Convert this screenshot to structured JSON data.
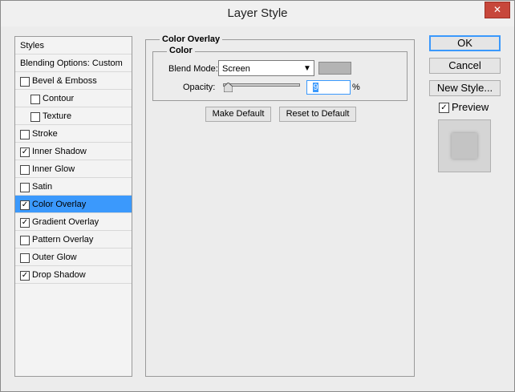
{
  "window": {
    "title": "Layer Style",
    "close_glyph": "✕"
  },
  "styles_list": {
    "items": [
      {
        "label": "Styles",
        "checkbox": false,
        "checked": false,
        "indent": 0,
        "selected": false
      },
      {
        "label": "Blending Options: Custom",
        "checkbox": false,
        "checked": false,
        "indent": 0,
        "selected": false
      },
      {
        "label": "Bevel & Emboss",
        "checkbox": true,
        "checked": false,
        "indent": 0,
        "selected": false
      },
      {
        "label": "Contour",
        "checkbox": true,
        "checked": false,
        "indent": 1,
        "selected": false
      },
      {
        "label": "Texture",
        "checkbox": true,
        "checked": false,
        "indent": 1,
        "selected": false
      },
      {
        "label": "Stroke",
        "checkbox": true,
        "checked": false,
        "indent": 0,
        "selected": false
      },
      {
        "label": "Inner Shadow",
        "checkbox": true,
        "checked": true,
        "indent": 0,
        "selected": false
      },
      {
        "label": "Inner Glow",
        "checkbox": true,
        "checked": false,
        "indent": 0,
        "selected": false
      },
      {
        "label": "Satin",
        "checkbox": true,
        "checked": false,
        "indent": 0,
        "selected": false
      },
      {
        "label": "Color Overlay",
        "checkbox": true,
        "checked": true,
        "indent": 0,
        "selected": true
      },
      {
        "label": "Gradient Overlay",
        "checkbox": true,
        "checked": true,
        "indent": 0,
        "selected": false
      },
      {
        "label": "Pattern Overlay",
        "checkbox": true,
        "checked": false,
        "indent": 0,
        "selected": false
      },
      {
        "label": "Outer Glow",
        "checkbox": true,
        "checked": false,
        "indent": 0,
        "selected": false
      },
      {
        "label": "Drop Shadow",
        "checkbox": true,
        "checked": true,
        "indent": 0,
        "selected": false
      }
    ],
    "check_glyph": "✓"
  },
  "color_overlay": {
    "group_title": "Color Overlay",
    "subgroup_title": "Color",
    "blend_mode_label": "Blend Mode:",
    "blend_mode_value": "Screen",
    "color_swatch": "#b4b4b4",
    "opacity_label": "Opacity:",
    "opacity_value": "9",
    "opacity_unit": "%",
    "make_default_label": "Make Default",
    "reset_default_label": "Reset to Default"
  },
  "actions": {
    "ok_label": "OK",
    "cancel_label": "Cancel",
    "new_style_label": "New Style...",
    "preview_label": "Preview",
    "preview_checked": true
  },
  "colors": {
    "selection": "#3b99fc",
    "dialog_bg": "#ececec"
  }
}
